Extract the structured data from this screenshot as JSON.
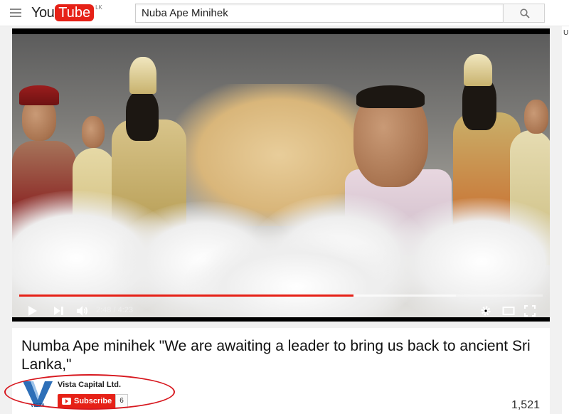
{
  "header": {
    "logo_you": "You",
    "logo_tube": "Tube",
    "region": "LK",
    "search_value": "Nuba Ape Minihek"
  },
  "right_rail": {
    "letter": "U"
  },
  "player": {
    "current_time": "2:48",
    "duration": "4:23",
    "time_display": "2:48 / 4:23",
    "progress_fraction": 0.639,
    "loaded_fraction": 0.834
  },
  "video": {
    "title": "Numba Ape minihek \"We are awaiting a leader to bring us back to ancient Sri Lanka,\"",
    "channel_name": "Vista Capital Ltd.",
    "avatar_text": "VISTA",
    "subscribe_label": "Subscribe",
    "subscriber_count": "6",
    "view_count": "1,521"
  },
  "colors": {
    "brand_red": "#e62117",
    "annotation_red": "#d7181f"
  }
}
